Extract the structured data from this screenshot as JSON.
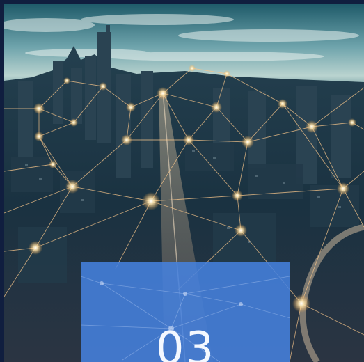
{
  "tile": {
    "number": "03"
  },
  "colors": {
    "border": "#101e3f",
    "card": "#4682e1",
    "network_line": "#f7c58a",
    "node_glow": "#fff2cc"
  },
  "image": {
    "icon": "city-network-photo"
  }
}
